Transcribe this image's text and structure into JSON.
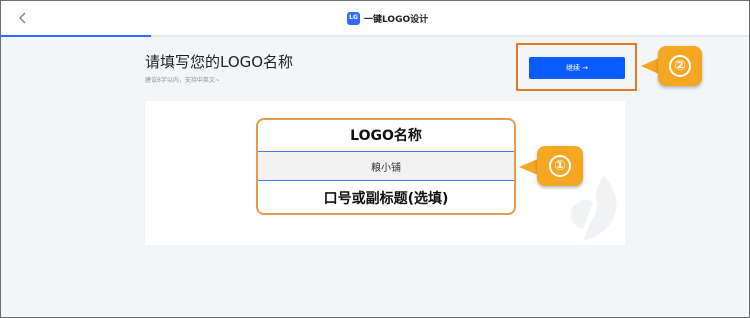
{
  "topbar": {
    "app_title": "一键LOGO设计",
    "app_logo_text": "LG",
    "progress_fraction": 0.2
  },
  "header": {
    "title": "请填写您的LOGO名称",
    "subtitle": "建议6字以内，支持中英文~"
  },
  "actions": {
    "continue_label": "继续 →"
  },
  "form": {
    "name_label": "LOGO名称",
    "name_value": "粮小铺",
    "slogan_label": "口号或副标题(选填)"
  },
  "callouts": {
    "one": "①",
    "two": "②"
  },
  "colors": {
    "accent": "#0a5cff",
    "highlight": "#e07b24",
    "callout": "#f5a623"
  }
}
